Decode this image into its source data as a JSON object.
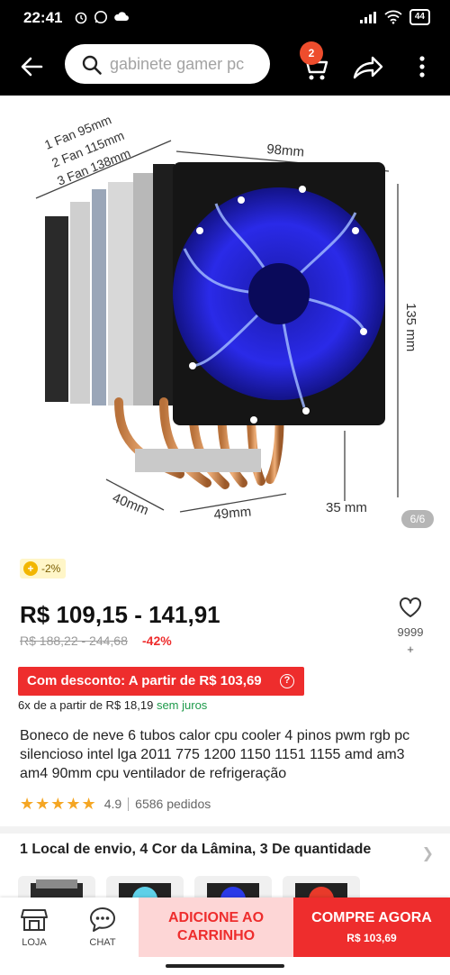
{
  "status_bar": {
    "time": "22:41",
    "battery": "44"
  },
  "search": {
    "placeholder": "gabinete gamer pc"
  },
  "cart": {
    "badge_count": "2"
  },
  "product_image": {
    "counter": "6/6",
    "fan_sizes": [
      "1 Fan 95mm",
      "2 Fan 115mm",
      "3 Fan 138mm"
    ],
    "dim_width": "98mm",
    "dim_height": "135 mm",
    "dim_depth": "40mm",
    "dim_base": "49mm",
    "dim_clearance": "35 mm"
  },
  "promo": {
    "coin_discount": "-2%"
  },
  "price": {
    "range": "R$ 109,15 - 141,91",
    "original_range": "R$ 188,22 - 244,68",
    "discount": "-42%"
  },
  "favorites": {
    "count": "9999",
    "plus": "+"
  },
  "deal": {
    "label": "Com desconto: A partir de R$ 103,69",
    "info_icon": "?"
  },
  "installments": {
    "text": "6x de a partir de R$ 18,19",
    "interest": "sem juros"
  },
  "product": {
    "title": "Boneco de neve 6 tubos calor cpu cooler 4 pinos pwm rgb pc silencioso intel lga 2011 775 1200 1150 1151 1155 amd am3 am4 90mm cpu ventilador de refrigeração"
  },
  "rating": {
    "stars": "★★★★★",
    "value": "4.9",
    "orders": "6586 pedidos"
  },
  "options": {
    "summary": "1 Local de envio, 4 Cor da Lâmina, 3 De quantidade"
  },
  "bottom_bar": {
    "store_label": "LOJA",
    "chat_label": "CHAT",
    "add_cart_line1": "ADICIONE AO",
    "add_cart_line2": "CARRINHO",
    "buy_now_label": "COMPRE AGORA",
    "buy_now_price": "R$ 103,69"
  },
  "colors": {
    "accent_red": "#ee2d2d",
    "badge_orange": "#ee4d2d",
    "star_gold": "#f5a623",
    "green": "#1d9a4a"
  }
}
